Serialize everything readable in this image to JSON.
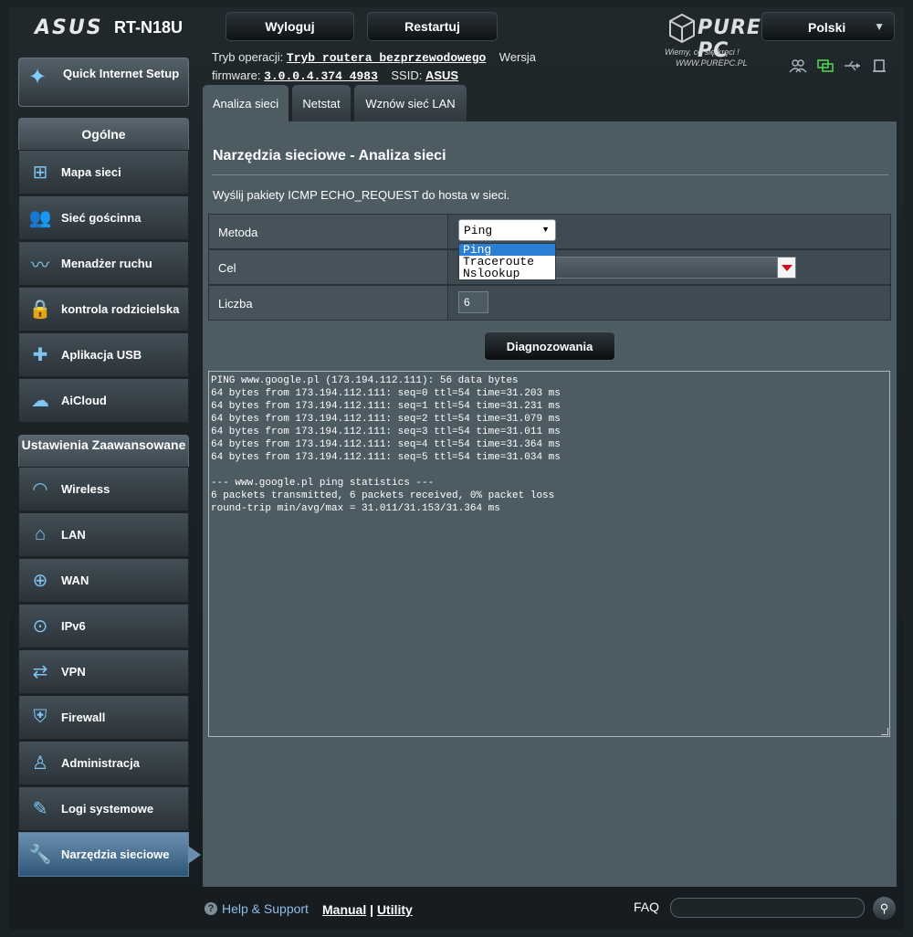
{
  "header": {
    "brand": "ASUS",
    "model": "RT-N18U",
    "logout_label": "Wyloguj",
    "restart_label": "Restartuj",
    "language": "Polski",
    "watermark_brand": "PURE PC",
    "watermark_slogan": "Wiemy, co się kręci !",
    "watermark_url": "WWW.PUREPC.PL",
    "op_mode_label": "Tryb operacji:",
    "op_mode_value": "Tryb routera bezprzewodowego",
    "version_label": "Wersja",
    "firmware_label": "firmware:",
    "firmware_value": "3.0.0.4.374_4983",
    "ssid_label": "SSID:",
    "ssid_value": "ASUS",
    "status_icons": [
      "clients-icon",
      "network-status-icon",
      "usb-icon",
      "printer-icon"
    ]
  },
  "sidebar": {
    "quick_setup_label": "Quick Internet Setup",
    "general_header": "Ogólne",
    "general_items": [
      {
        "label": "Mapa sieci",
        "icon": "network-map-icon"
      },
      {
        "label": "Sieć gościnna",
        "icon": "guest-network-icon"
      },
      {
        "label": "Menadżer ruchu",
        "icon": "traffic-manager-icon"
      },
      {
        "label": "kontrola rodzicielska",
        "icon": "lock-icon"
      },
      {
        "label": "Aplikacja USB",
        "icon": "puzzle-icon"
      },
      {
        "label": "AiCloud",
        "icon": "cloud-icon"
      }
    ],
    "advanced_header": "Ustawienia Zaawansowane",
    "advanced_items": [
      {
        "label": "Wireless",
        "icon": "wifi-icon"
      },
      {
        "label": "LAN",
        "icon": "home-icon"
      },
      {
        "label": "WAN",
        "icon": "globe-icon"
      },
      {
        "label": "IPv6",
        "icon": "ipv6-icon"
      },
      {
        "label": "VPN",
        "icon": "vpn-icon"
      },
      {
        "label": "Firewall",
        "icon": "shield-icon"
      },
      {
        "label": "Administracja",
        "icon": "admin-user-icon"
      },
      {
        "label": "Logi systemowe",
        "icon": "log-edit-icon"
      },
      {
        "label": "Narzędzia sieciowe",
        "icon": "wrench-icon",
        "active": true
      }
    ]
  },
  "tabs": [
    "Analiza sieci",
    "Netstat",
    "Wznów sieć LAN"
  ],
  "main": {
    "title": "Narzędzia sieciowe - Analiza sieci",
    "description": "Wyślij pakiety ICMP ECHO_REQUEST do hosta w sieci.",
    "method_label": "Metoda",
    "method_value": "Ping",
    "method_options": [
      "Ping",
      "Traceroute",
      "Nslookup"
    ],
    "target_label": "Cel",
    "target_value": "",
    "count_label": "Liczba",
    "count_value": "6",
    "diagnose_label": "Diagnozowania",
    "output": "PING www.google.pl (173.194.112.111): 56 data bytes\n64 bytes from 173.194.112.111: seq=0 ttl=54 time=31.203 ms\n64 bytes from 173.194.112.111: seq=1 ttl=54 time=31.231 ms\n64 bytes from 173.194.112.111: seq=2 ttl=54 time=31.079 ms\n64 bytes from 173.194.112.111: seq=3 ttl=54 time=31.011 ms\n64 bytes from 173.194.112.111: seq=4 ttl=54 time=31.364 ms\n64 bytes from 173.194.112.111: seq=5 ttl=54 time=31.034 ms\n\n--- www.google.pl ping statistics ---\n6 packets transmitted, 6 packets received, 0% packet loss\nround-trip min/avg/max = 31.011/31.153/31.364 ms"
  },
  "footer": {
    "help_label": "Help & Support",
    "manual_label": "Manual",
    "separator": "|",
    "utility_label": "Utility",
    "faq_label": "FAQ",
    "faq_placeholder": ""
  },
  "colors": {
    "background": "#1c2327",
    "panel": "#4d5b63",
    "active_nav": "#4f7396",
    "accent_icon": "#7fc4f2",
    "selection": "#2b7fd4"
  }
}
